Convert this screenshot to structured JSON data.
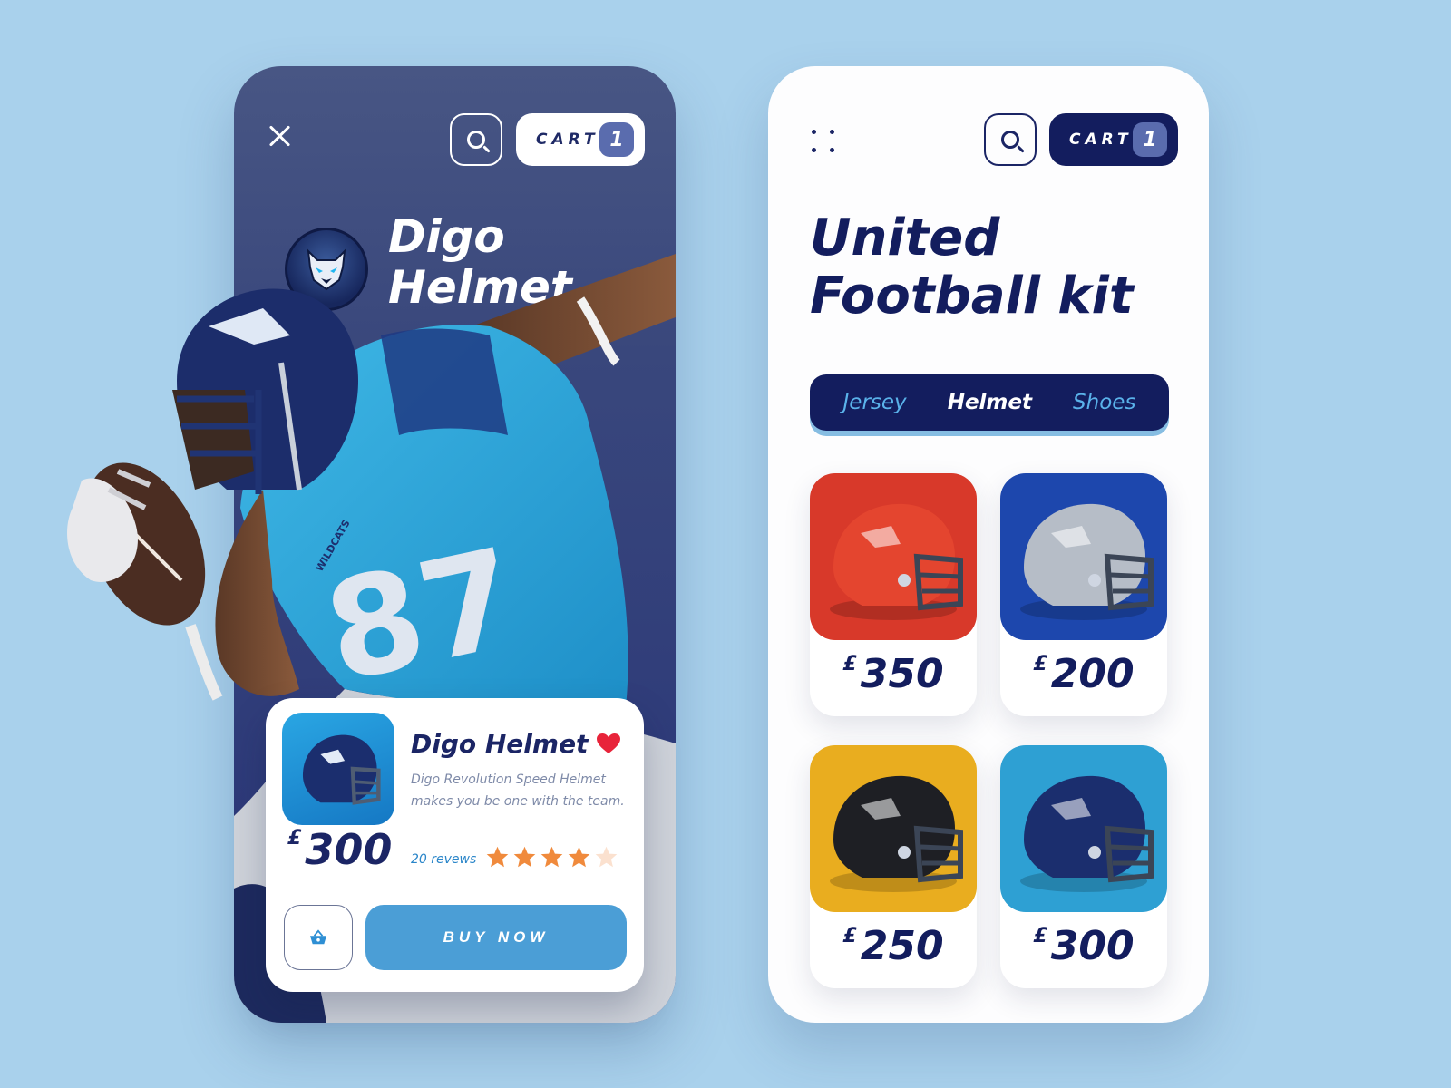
{
  "colors": {
    "background": "#a9d1ec",
    "navy": "#131d5e",
    "accent_blue": "#4b9ed6",
    "cart_badge": "#5a6cae",
    "tab_inactive": "#5ab2ea",
    "heart": "#e8243a",
    "star": "#f08a3c"
  },
  "detail_screen": {
    "cart": {
      "label": "CART",
      "count": "1"
    },
    "title_line1": "Digo",
    "title_line2": "Helmet",
    "jersey_text": "WILDCATS",
    "jersey_number": "87",
    "product_card": {
      "title": "Digo Helmet",
      "description": "Digo Revolution Speed Helmet makes you be one with the team.",
      "currency": "£",
      "price": "300",
      "reviews": "20 revews",
      "rating": 4,
      "rating_max": 5,
      "buy_label": "BUY NOW"
    }
  },
  "catalogue_screen": {
    "cart": {
      "label": "CART",
      "count": "1"
    },
    "title_line1": "United",
    "title_line2": "Football kit",
    "tabs": [
      {
        "label": "Jersey",
        "active": false
      },
      {
        "label": "Helmet",
        "active": true
      },
      {
        "label": "Shoes",
        "active": false
      }
    ],
    "products": [
      {
        "currency": "£",
        "price": "350",
        "bg": "#d8392a",
        "shell": "#e4452f"
      },
      {
        "currency": "£",
        "price": "200",
        "bg": "#1d47ad",
        "shell": "#b6bdc7"
      },
      {
        "currency": "£",
        "price": "250",
        "bg": "#e9ad1f",
        "shell": "#1e1f24"
      },
      {
        "currency": "£",
        "price": "300",
        "bg": "#2ea0d3",
        "shell": "#1b2e6e"
      }
    ]
  }
}
